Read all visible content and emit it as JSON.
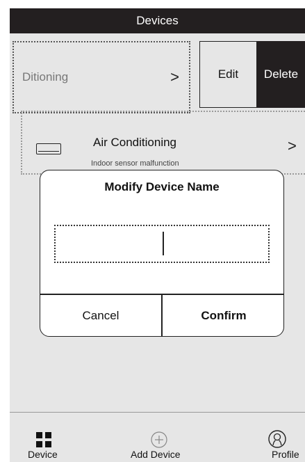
{
  "header": {
    "title": "Devices"
  },
  "swiped_item": {
    "name": "Ditioning",
    "chevron": ">",
    "edit_label": "Edit",
    "delete_label": "Delete"
  },
  "device": {
    "icon": "air-conditioner-icon",
    "name": "Air Conditioning",
    "status": "Indoor sensor malfunction",
    "chevron": ">"
  },
  "dialog": {
    "title": "Modify Device Name",
    "input_value": "",
    "cancel_label": "Cancel",
    "confirm_label": "Confirm"
  },
  "bottom_nav": {
    "items": [
      {
        "label": "Device",
        "icon": "grid-icon"
      },
      {
        "label": "Add Device",
        "icon": "add-circle-icon"
      },
      {
        "label": "Profile",
        "icon": "profile-icon"
      }
    ]
  },
  "colors": {
    "header_bg": "#231f20",
    "screen_bg": "#e6e6e6",
    "dialog_bg": "#ffffff"
  }
}
